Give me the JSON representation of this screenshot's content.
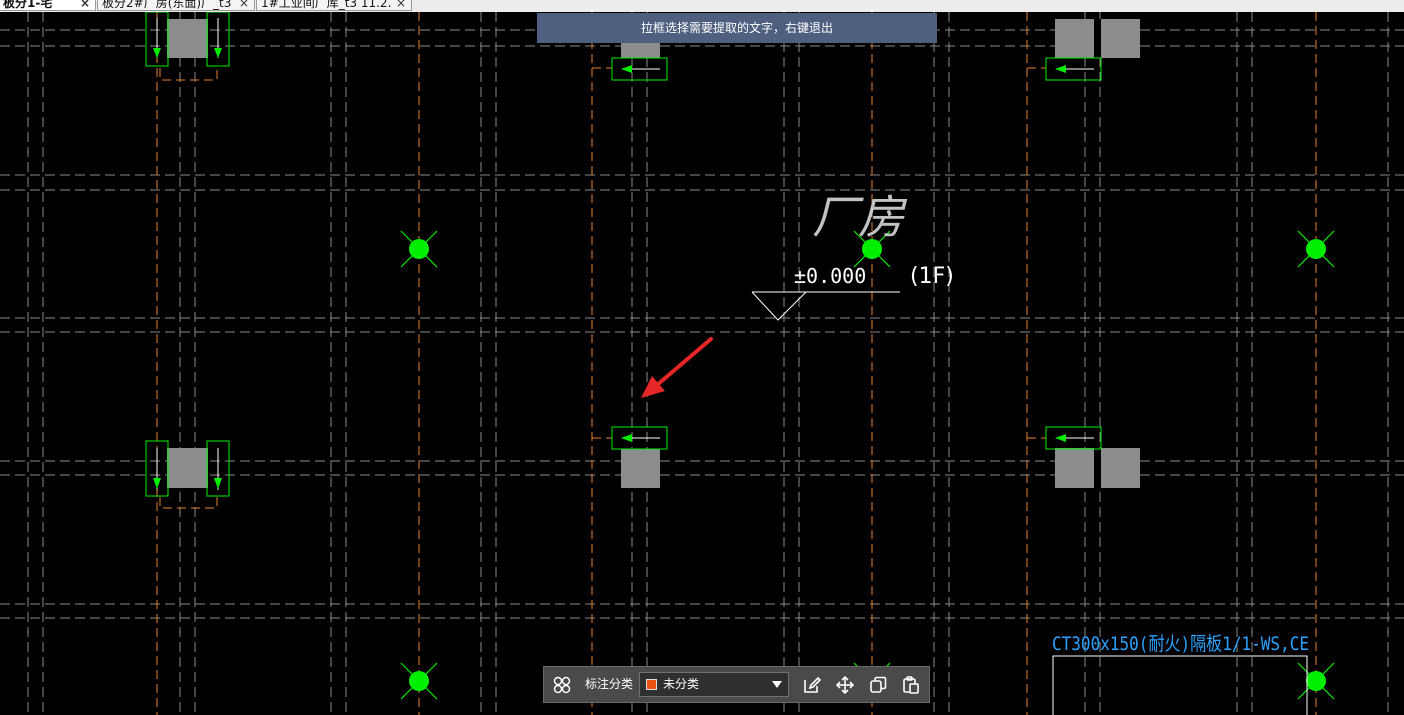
{
  "tabs": [
    {
      "label": "板分1-宅"
    },
    {
      "label": "板分2#厂房(东面)厂_t3"
    },
    {
      "label": "1#工业间厂库_t3 11.2."
    }
  ],
  "tab_close_glyph": "×",
  "banner": {
    "text": "拉框选择需要提取的文字，右键退出"
  },
  "drawing_text": {
    "room_name": "厂房",
    "elevation": "±0.000",
    "floor": "(1F)",
    "beam_label": "CT300x150(耐火)隔板1/1-WS,CE"
  },
  "toolbar": {
    "label": "标注分类",
    "category_value": "未分类",
    "category_color": "#e8540f"
  },
  "icons": {
    "toolbar_left": "layout-grid-icon",
    "dropdown": "chevron-down-icon",
    "edit": "edit-icon",
    "move": "move-icon",
    "copy": "copy-icon",
    "paste": "paste-icon"
  },
  "colors": {
    "background": "#000000",
    "grid_dashed": "#8a8a8a",
    "axis_orange": "#e8802a",
    "highlight_green": "#00ee00",
    "column_gray": "#8c8c8c",
    "annotation_cyan": "#29a3ff",
    "arrow_red": "#e52727",
    "banner_bg": "#4f5f7f"
  }
}
